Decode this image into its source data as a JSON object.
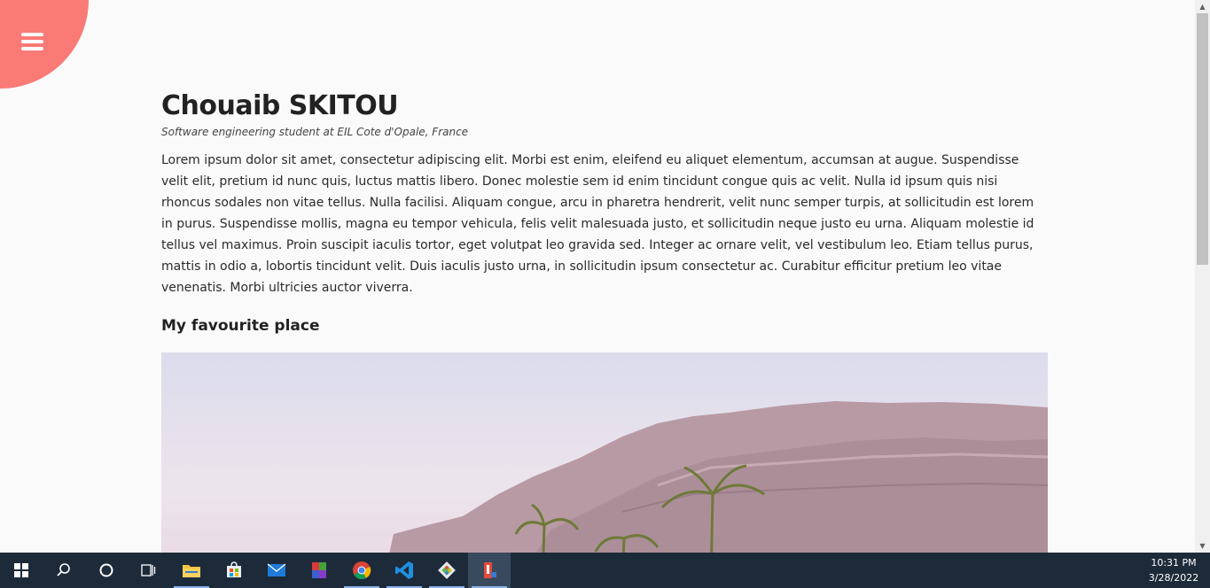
{
  "profile": {
    "name": "Chouaib SKITOU",
    "tagline": "Software engineering student at EIL Cote d'Opale, France",
    "bio": "Lorem ipsum dolor sit amet, consectetur adipiscing elit. Morbi est enim, eleifend eu aliquet elementum, accumsan at augue. Suspendisse velit elit, pretium id nunc quis, luctus mattis libero. Donec molestie sem id enim tincidunt congue quis ac velit. Nulla id ipsum quis nisi rhoncus sodales non vitae tellus. Nulla facilisi. Aliquam congue, arcu in pharetra hendrerit, velit nunc semper turpis, at sollicitudin est lorem in purus. Suspendisse mollis, magna eu tempor vehicula, felis velit malesuada justo, et sollicitudin neque justo eu urna. Aliquam molestie id tellus vel maximus. Proin suscipit iaculis tortor, eget volutpat leo gravida sed. Integer ac ornare velit, vel vestibulum leo. Etiam tellus purus, mattis in odio a, lobortis tincidunt velit. Duis iaculis justo urna, in sollicitudin ipsum consectetur ac. Curabitur efficitur pretium leo vitae venenatis. Morbi ultricies auctor viverra.",
    "section_title": "My favourite place"
  },
  "colors": {
    "menu_accent": "#fa7a76",
    "taskbar": "#1d2a3a"
  },
  "taskbar": {
    "items": [
      "windows-start-icon",
      "search-icon",
      "cortana-icon",
      "task-view-icon",
      "file-explorer-icon",
      "microsoft-store-icon",
      "mail-icon",
      "winrar-icon",
      "chrome-icon",
      "vscode-icon",
      "git-icon",
      "app-icon"
    ],
    "time": "10:31 PM",
    "date": "3/28/2022"
  }
}
